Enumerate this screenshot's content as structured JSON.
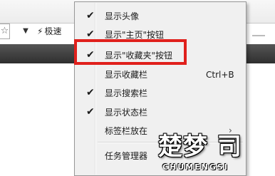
{
  "toolbar": {
    "star_glyph": "☆",
    "dropdown_glyph": "▼",
    "quick_icon": "⚡",
    "quick_label": "极速"
  },
  "menu": {
    "items": [
      {
        "label": "显示头像",
        "checked": true,
        "check": "✔",
        "shortcut": "",
        "submenu": false
      },
      {
        "label": "显示\"主页\"按钮",
        "checked": true,
        "check": "✔",
        "shortcut": "",
        "submenu": false
      },
      {
        "label": "显示\"收藏夹\"按钮",
        "checked": true,
        "check": "✔",
        "shortcut": "",
        "submenu": false
      },
      {
        "label": "显示收藏栏",
        "checked": false,
        "check": "",
        "shortcut": "Ctrl+B",
        "submenu": false
      },
      {
        "label": "显示搜索栏",
        "checked": true,
        "check": "✔",
        "shortcut": "",
        "submenu": false
      },
      {
        "label": "显示状态栏",
        "checked": true,
        "check": "✔",
        "shortcut": "",
        "submenu": false
      },
      {
        "label": "标签栏放在",
        "checked": false,
        "check": "",
        "shortcut": "",
        "submenu": true,
        "arrow": "›"
      },
      {
        "label": "任务管理器",
        "checked": false,
        "check": "",
        "shortcut": "",
        "submenu": false
      }
    ],
    "highlight_color": "#e0201c"
  },
  "watermark": {
    "main": "楚梦 司",
    "sub": "CHUMENGSI"
  }
}
